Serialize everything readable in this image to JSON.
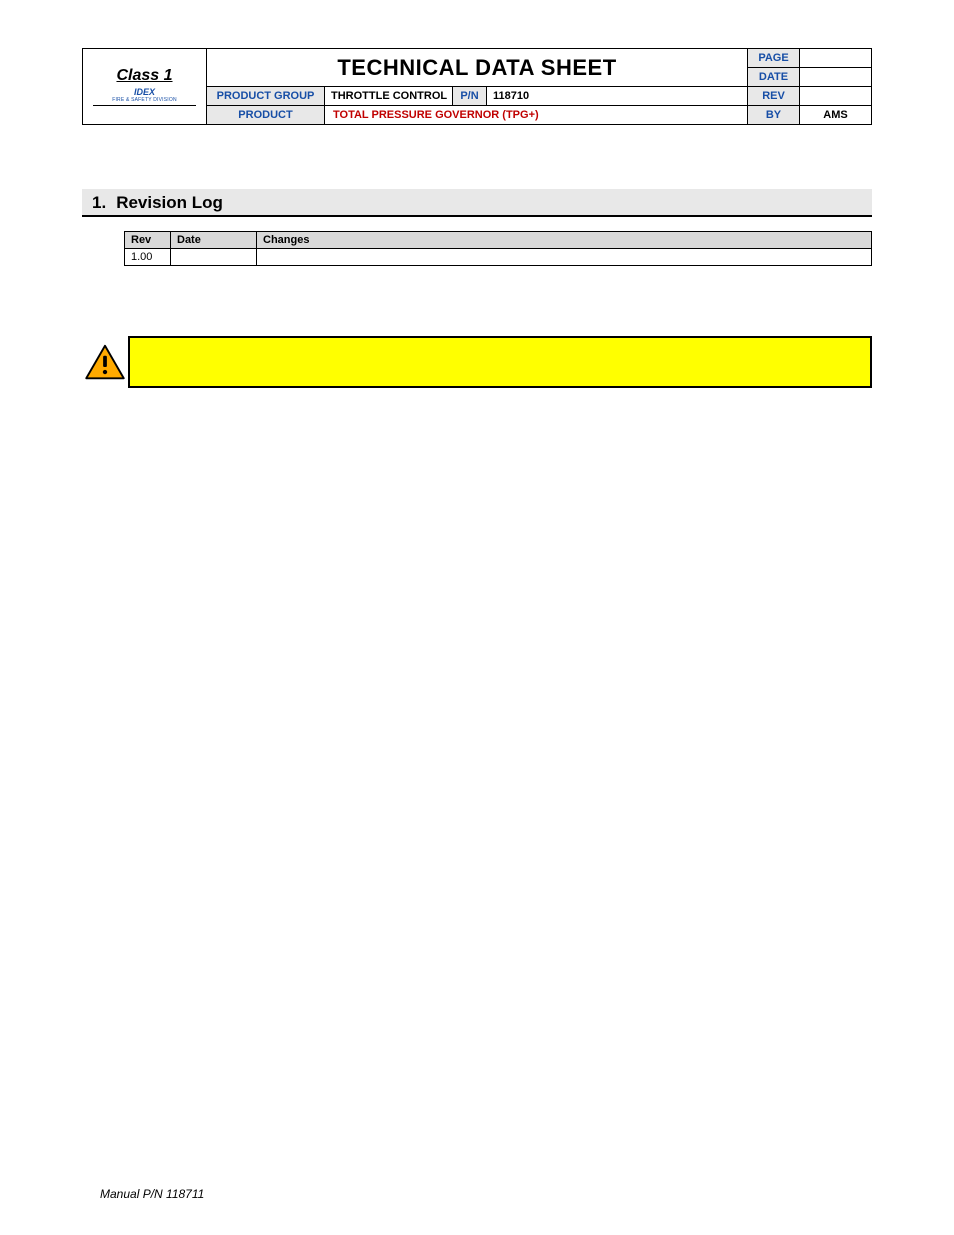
{
  "logo": {
    "line1": "Class 1",
    "line2": "IDEX",
    "subline": "FIRE & SAFETY DIVISION"
  },
  "header": {
    "title": "TECHNICAL DATA SHEET",
    "labels": {
      "page": "PAGE",
      "date": "DATE",
      "rev": "REV",
      "by": "BY",
      "product_group": "PRODUCT GROUP",
      "pn": "P/N",
      "product": "PRODUCT"
    },
    "product_group": "THROTTLE CONTROL",
    "pn": "118710",
    "product": "TOTAL PRESSURE GOVERNOR        (TPG+)",
    "page": "",
    "date": "",
    "rev": "",
    "by": "AMS"
  },
  "section": {
    "number": "1.",
    "title": "Revision Log"
  },
  "revlog": {
    "headers": {
      "rev": "Rev",
      "date": "Date",
      "changes": "Changes"
    },
    "rows": [
      {
        "rev": "1.00",
        "date": "",
        "changes": ""
      }
    ]
  },
  "footer": "Manual P/N 118711"
}
